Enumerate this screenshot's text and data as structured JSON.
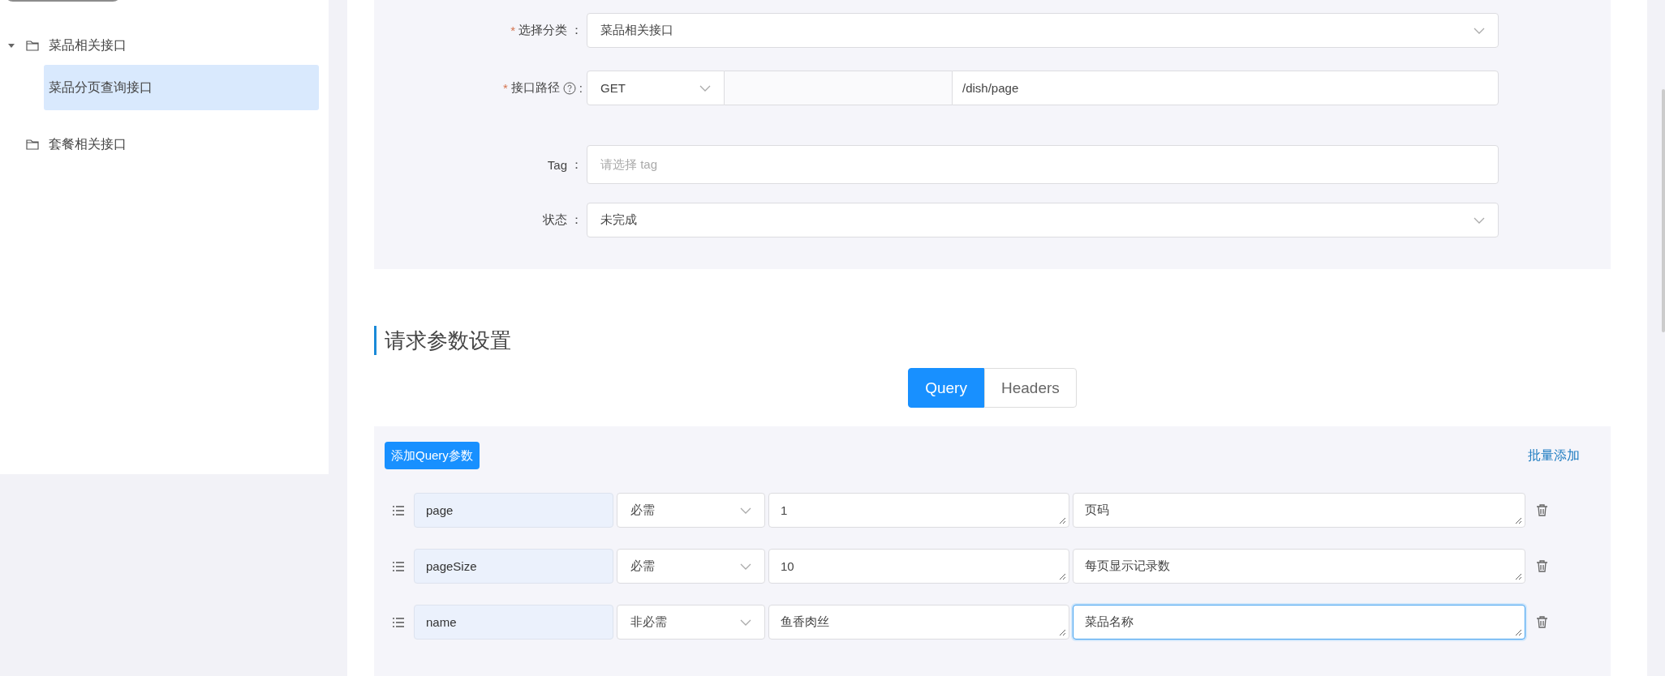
{
  "sidebar": {
    "tree": [
      {
        "label": "菜品相关接口",
        "selected": false,
        "expanded": true,
        "children": [
          {
            "label": "菜品分页查询接口",
            "selected": true
          }
        ]
      },
      {
        "label": "套餐相关接口",
        "selected": false
      }
    ]
  },
  "form": {
    "fields": [
      {
        "kind": "select",
        "required_mark": "*",
        "label": "选择分类",
        "colon": "：",
        "value": "菜品相关接口"
      },
      {
        "kind": "path",
        "required_mark": "*",
        "label": "接口路径",
        "help": true,
        "colon": ":",
        "method": "GET",
        "path": "/dish/page"
      },
      {
        "kind": "input",
        "label": "Tag",
        "colon": "：",
        "placeholder": "请选择 tag"
      },
      {
        "kind": "select",
        "label": "状态",
        "colon": "：",
        "value": "未完成"
      }
    ]
  },
  "section_title": "请求参数设置",
  "tabs": [
    {
      "label": "Query",
      "selected": true
    },
    {
      "label": "Headers",
      "selected": false
    }
  ],
  "query": {
    "add_button": "添加Query参数",
    "bulk_link": "批量添加",
    "params": [
      {
        "name": "page",
        "required": "必需",
        "value": "1",
        "description": "页码",
        "focused": false
      },
      {
        "name": "pageSize",
        "required": "必需",
        "value": "10",
        "description": "每页显示记录数",
        "focused": false
      },
      {
        "name": "name",
        "required": "非必需",
        "value": "鱼香肉丝",
        "description": "菜品名称",
        "focused": true
      }
    ]
  }
}
